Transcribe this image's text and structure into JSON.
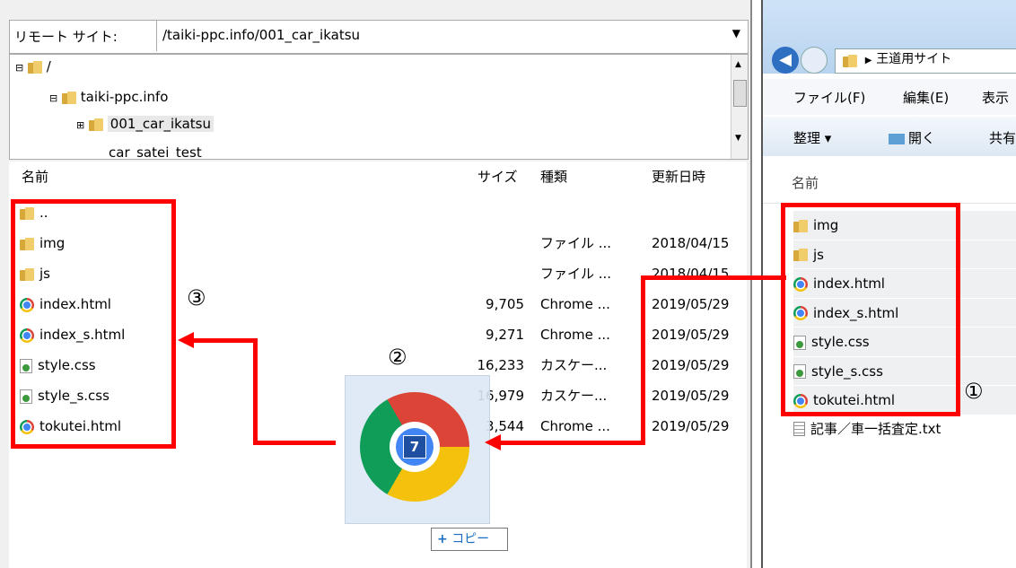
{
  "remote": {
    "label": "リモート サイト:",
    "path": "/taiki-ppc.info/001_car_ikatsu",
    "tree": [
      "/",
      "taiki-ppc.info",
      "001_car_ikatsu",
      "car_satei_test"
    ],
    "headers": {
      "name": "名前",
      "size": "サイズ",
      "type": "種類",
      "date": "更新日時"
    },
    "files": [
      {
        "name": "..",
        "icon": "folder-icon",
        "size": "",
        "type": "",
        "date": ""
      },
      {
        "name": "img",
        "icon": "folder-icon",
        "size": "",
        "type": "ファイル ...",
        "date": "2018/04/15"
      },
      {
        "name": "js",
        "icon": "folder-icon",
        "size": "",
        "type": "ファイル ...",
        "date": "2018/04/15"
      },
      {
        "name": "index.html",
        "icon": "chrome-icon",
        "size": "9,705",
        "type": "Chrome ...",
        "date": "2019/05/29"
      },
      {
        "name": "index_s.html",
        "icon": "chrome-icon",
        "size": "9,271",
        "type": "Chrome ...",
        "date": "2019/05/29"
      },
      {
        "name": "style.css",
        "icon": "css-icon",
        "size": "16,233",
        "type": "カスケー...",
        "date": "2019/05/29"
      },
      {
        "name": "style_s.css",
        "icon": "css-icon",
        "size": "16,979",
        "type": "カスケー...",
        "date": "2019/05/29"
      },
      {
        "name": "tokutei.html",
        "icon": "chrome-icon",
        "size": "3,544",
        "type": "Chrome ...",
        "date": "2019/05/29"
      }
    ]
  },
  "explorer": {
    "breadcrumb": "王道用サイト",
    "menu": [
      "ファイル(F)",
      "編集(E)",
      "表示"
    ],
    "toolbar": {
      "organize": "整理 ▾",
      "open": "開く",
      "share": "共有"
    },
    "header_name": "名前",
    "files": [
      {
        "name": "img",
        "icon": "folder-icon"
      },
      {
        "name": "js",
        "icon": "folder-icon"
      },
      {
        "name": "index.html",
        "icon": "chrome-icon"
      },
      {
        "name": "index_s.html",
        "icon": "chrome-icon"
      },
      {
        "name": "style.css",
        "icon": "css-icon"
      },
      {
        "name": "style_s.css",
        "icon": "css-icon"
      },
      {
        "name": "tokutei.html",
        "icon": "chrome-icon"
      },
      {
        "name": "記事／車一括査定.txt",
        "icon": "text-file-icon"
      }
    ]
  },
  "drag": {
    "count": "7",
    "copy_label": "コピー",
    "copy_symbol": "+"
  },
  "annotations": {
    "one": "①",
    "two": "②",
    "three": "③"
  },
  "colors": {
    "annotation": "#ff0000",
    "header_bg": "#f2f2f2"
  }
}
